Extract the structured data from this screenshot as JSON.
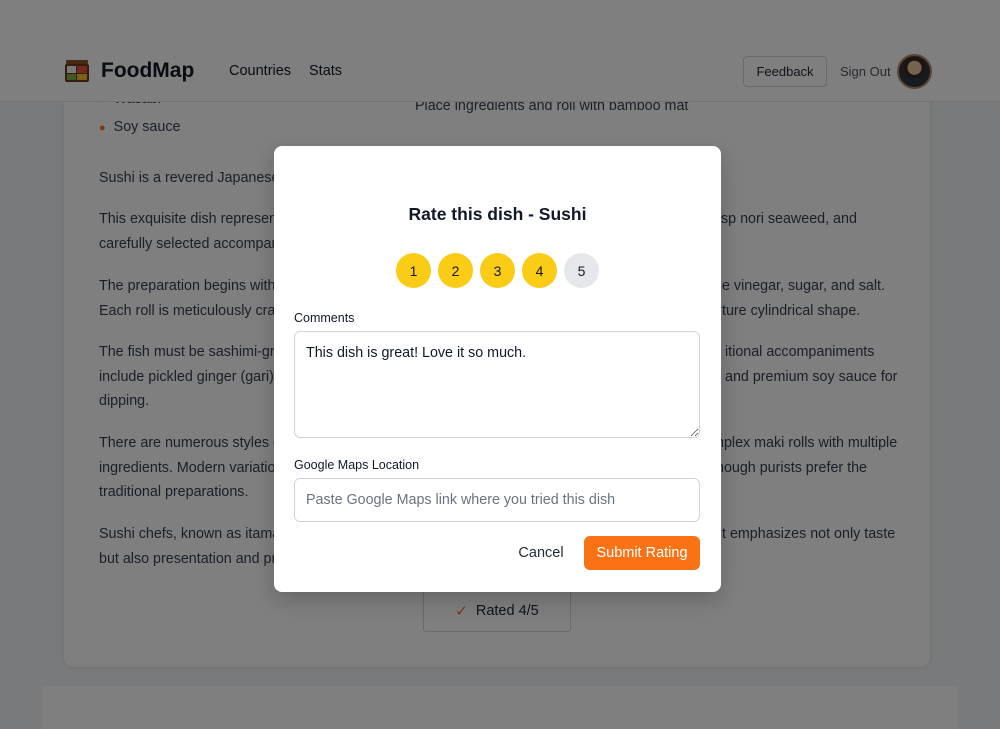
{
  "app": {
    "title": "FoodMap",
    "logo_icon": "bento-box-icon"
  },
  "nav": {
    "countries": "Countries",
    "stats": "Stats"
  },
  "header": {
    "feedback_label": "Feedback",
    "signout_label": "Sign Out"
  },
  "ingredients": {
    "partial_item": "Wasabi",
    "item": "Soy sauce"
  },
  "step_text": "Place ingredients and roll with bamboo mat",
  "paragraphs": [
    {
      "line1": "Sushi is a revered Japanese",
      "line1_right": "."
    },
    {
      "line1": "This exquisite dish represent",
      "line1_right": "sp nori seaweed, and",
      "line2": "carefully selected accompan"
    },
    {
      "line1": "The preparation begins with",
      "line1_right": "e vinegar, sugar, and salt.",
      "line2": "Each roll is meticulously craf",
      "line2_right": "ture cylindrical shape."
    },
    {
      "line1": "The fish must be sashimi-gra",
      "line1_right": "itional accompaniments",
      "line2": "include pickled ginger (gari)",
      "line2_right": "and premium soy sauce for",
      "line3": "dipping."
    },
    {
      "line1": "There are numerous styles c",
      "line1_right": "nplex maki rolls with multiple",
      "line2": "ingredients. Modern variatio",
      "line2_right": "hough purists prefer the",
      "line3": "traditional preparations."
    },
    {
      "line1": "Sushi chefs, known as itama",
      "line1_right": "t emphasizes not only taste",
      "line2": "but also presentation and pr"
    }
  ],
  "rated": {
    "label": "Rated 4/5",
    "icon": "check-icon"
  },
  "modal": {
    "title": "Rate this dish - Sushi",
    "rating": 4,
    "rating_options": [
      "1",
      "2",
      "3",
      "4",
      "5"
    ],
    "comments_label": "Comments",
    "comments_value": "This dish is great! Love it so much.",
    "maps_label": "Google Maps Location",
    "maps_placeholder": "Paste Google Maps link where you tried this dish",
    "maps_value": "",
    "cancel_label": "Cancel",
    "submit_label": "Submit Rating"
  },
  "colors": {
    "accent": "#f97316",
    "star_active": "#facc15",
    "star_inactive": "#e5e7eb"
  }
}
